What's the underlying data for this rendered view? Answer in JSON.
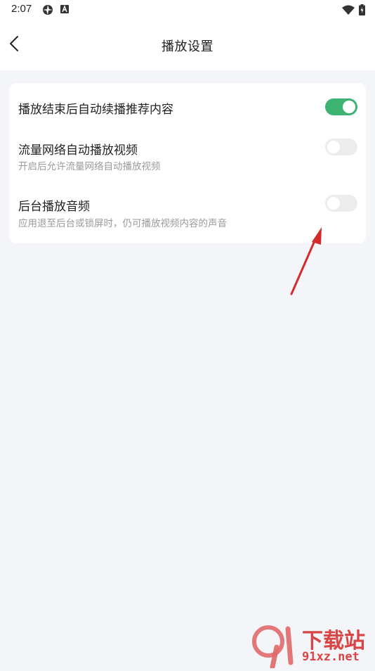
{
  "status_bar": {
    "time": "2:07",
    "icons": [
      "aperture-icon",
      "font-a-icon",
      "wifi-icon",
      "battery-charging-icon"
    ]
  },
  "header": {
    "title": "播放设置",
    "back_icon": "chevron-left-icon"
  },
  "settings": [
    {
      "title": "播放结束后自动续播推荐内容",
      "description": "",
      "enabled": true
    },
    {
      "title": "流量网络自动播放视频",
      "description": "开启后允许流量网络自动播放视频",
      "enabled": false
    },
    {
      "title": "后台播放音频",
      "description": "应用退至后台或锁屏时，仍可播放视频内容的声音",
      "enabled": false
    }
  ],
  "colors": {
    "accent_green": "#3cb371",
    "toggle_off": "#ececec",
    "background": "#f4f5f9",
    "arrow_red": "#d42a2a"
  },
  "watermark": {
    "logo_text": "下载站",
    "domain": "91xz.net"
  }
}
